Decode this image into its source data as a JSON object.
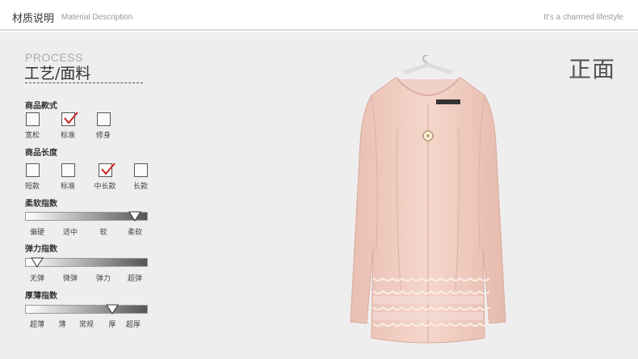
{
  "header": {
    "title": "材质说明",
    "subtitle": "Material Description",
    "tagline": "It’s a charmed lifestyle"
  },
  "panel": {
    "process_en": "PROCESS",
    "process_cn": "工艺/面料",
    "front_label": "正面"
  },
  "style": {
    "heading": "商品款式",
    "options": [
      "宽松",
      "标准",
      "修身"
    ],
    "selected": "标准"
  },
  "length": {
    "heading": "商品长度",
    "options": [
      "短款",
      "标准",
      "中长款",
      "长款"
    ],
    "selected": "中长款"
  },
  "softness": {
    "heading": "柔软指数",
    "ticks": [
      "偏硬",
      "适中",
      "软",
      "柔软"
    ],
    "selected": "柔软"
  },
  "elasticity": {
    "heading": "弹力指数",
    "ticks": [
      "无弹",
      "微弹",
      "弹力",
      "超弹"
    ],
    "selected": "无弹"
  },
  "thickness": {
    "heading": "厚薄指数",
    "ticks": [
      "超薄",
      "薄",
      "常规",
      "厚",
      "超厚"
    ],
    "selected": "厚"
  },
  "colors": {
    "coat": "#f2cfc3",
    "panel_bg": "#eeeeee",
    "check": "#cc2222"
  }
}
